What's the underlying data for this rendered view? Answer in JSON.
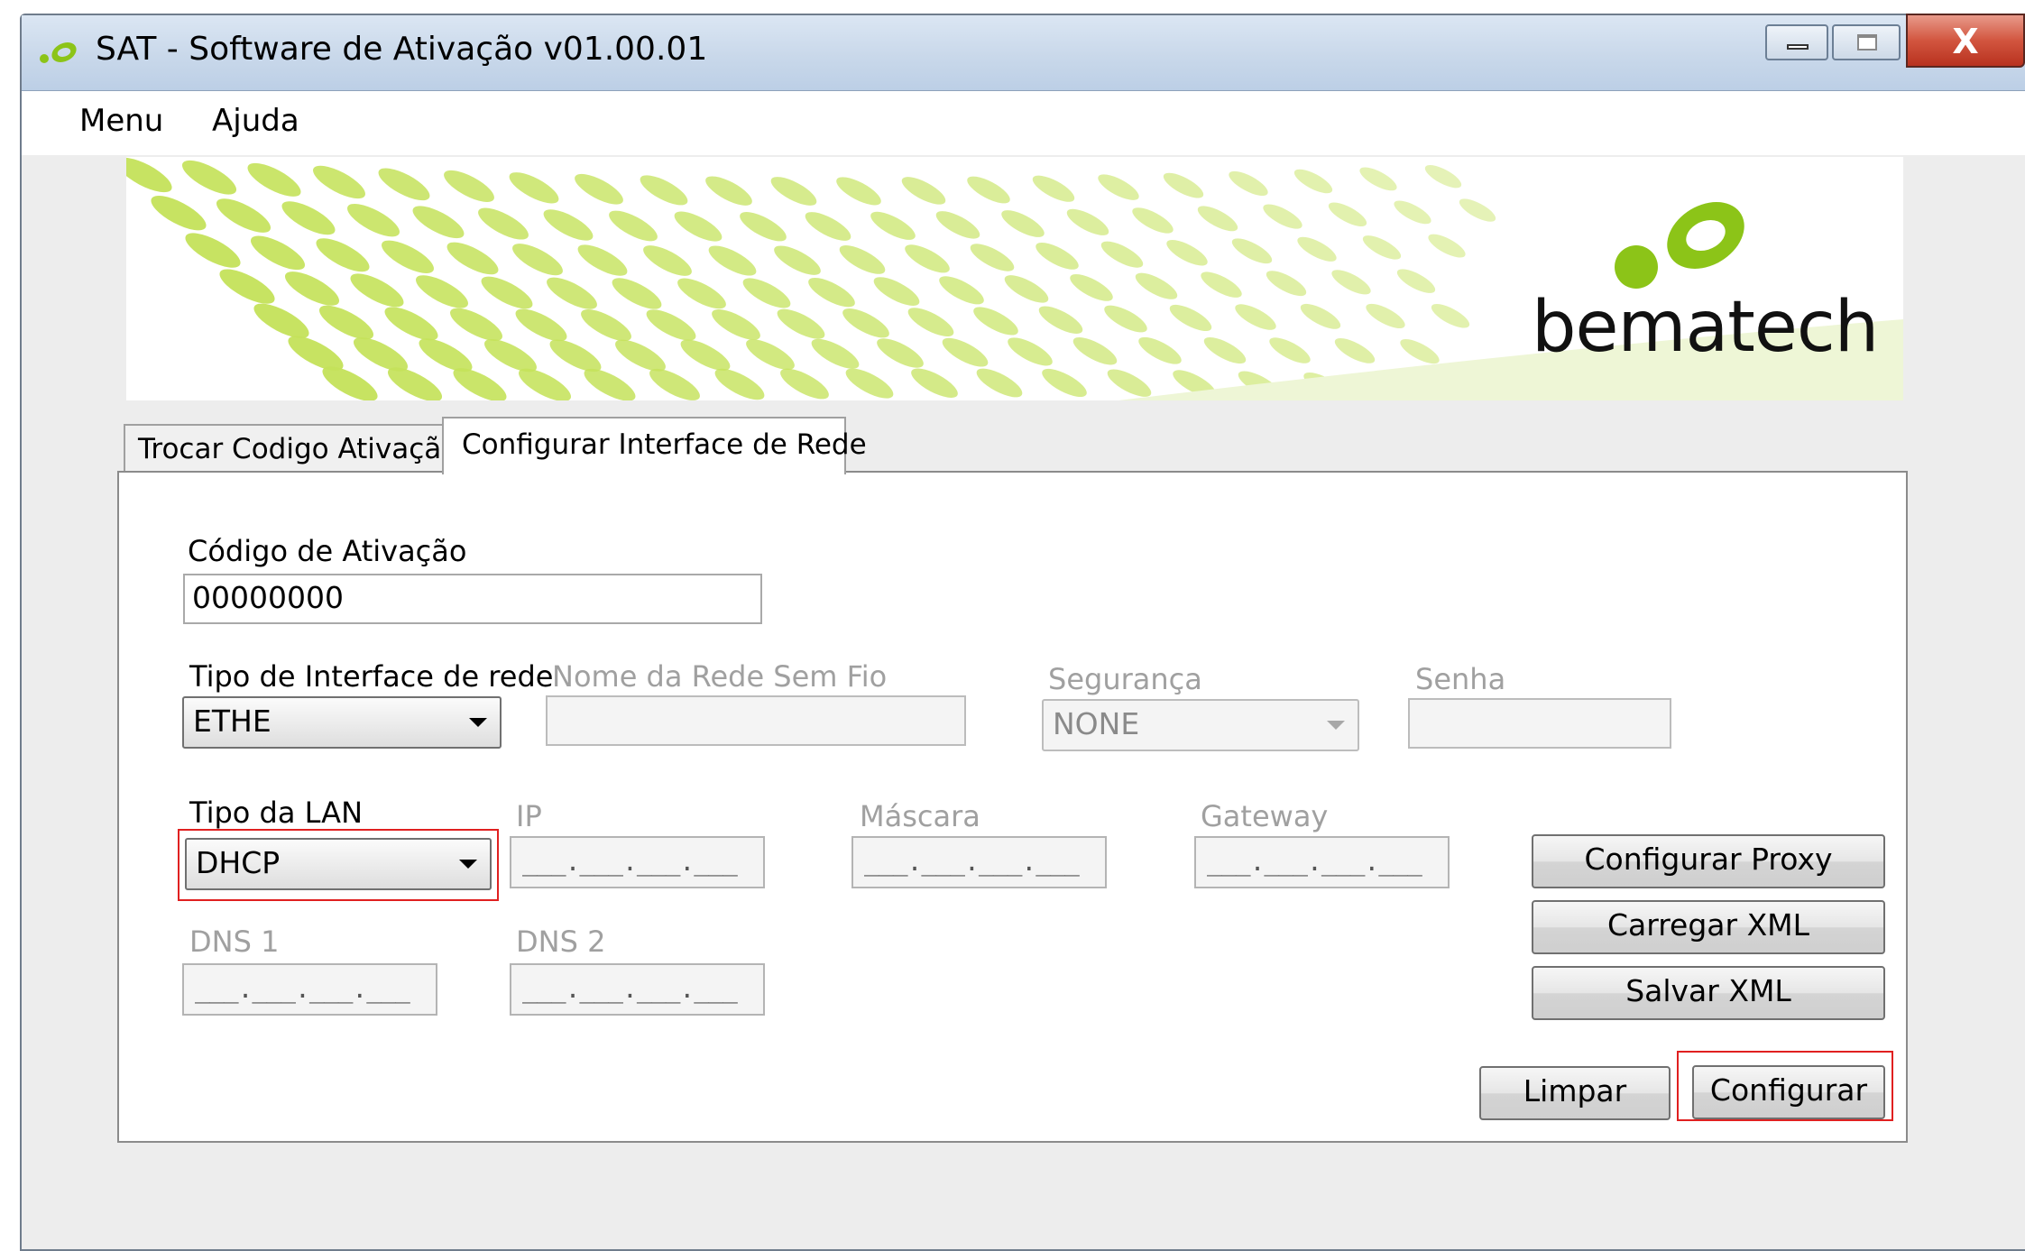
{
  "window": {
    "title": "SAT - Software de Ativação v01.00.01",
    "close_glyph": "X"
  },
  "menu": [
    "Menu",
    "Ajuda"
  ],
  "banner": {
    "brand": "bematech",
    "brand_color": "#8cc418"
  },
  "tabs": [
    {
      "label": "Trocar Codigo Ativação",
      "active": false
    },
    {
      "label": "Configurar Interface de Rede",
      "active": true
    }
  ],
  "form": {
    "activation_code": {
      "label": "Código de Ativação",
      "value": "00000000"
    },
    "interface_type": {
      "label": "Tipo de Interface de rede",
      "value": "ETHE"
    },
    "wifi_name": {
      "label": "Nome da Rede Sem Fio",
      "value": ""
    },
    "security": {
      "label": "Segurança",
      "value": "NONE"
    },
    "password": {
      "label": "Senha",
      "value": ""
    },
    "lan_type": {
      "label": "Tipo da LAN",
      "value": "DHCP"
    },
    "ip": {
      "label": "IP",
      "mask": "___.___.___.___"
    },
    "netmask": {
      "label": "Máscara",
      "mask": "___.___.___.___"
    },
    "gateway": {
      "label": "Gateway",
      "mask": "___.___.___.___"
    },
    "dns1": {
      "label": "DNS 1",
      "mask": "___.___.___.___"
    },
    "dns2": {
      "label": "DNS 2",
      "mask": "___.___.___.___"
    }
  },
  "buttons": {
    "proxy": "Configurar Proxy",
    "load_xml": "Carregar XML",
    "save_xml": "Salvar XML",
    "clear": "Limpar",
    "configure": "Configurar"
  },
  "colors": {
    "highlight": "#e02020",
    "titlebar": "#c9d8ea"
  }
}
